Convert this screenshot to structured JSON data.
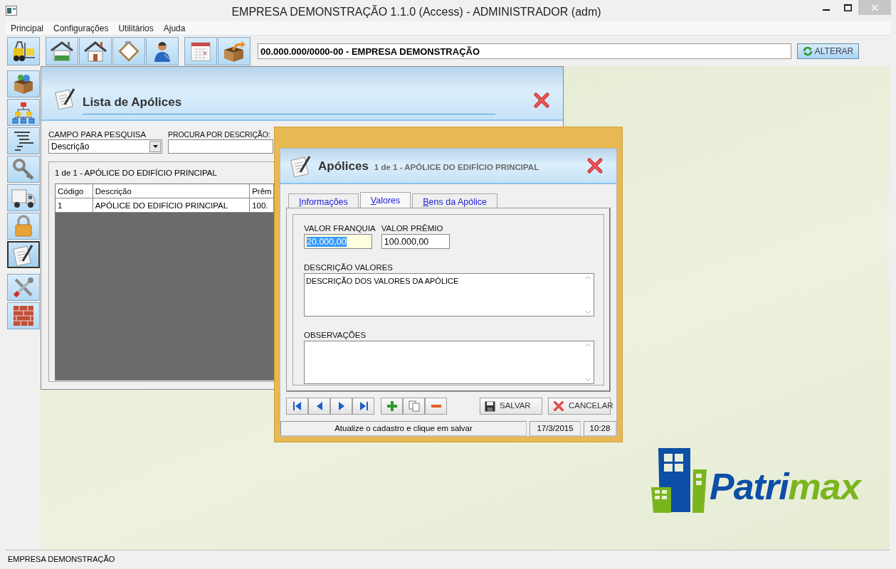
{
  "window": {
    "title": "EMPRESA DEMONSTRAÇÃO 1.1.0 (Access) - ADMINISTRADOR (adm)"
  },
  "menu": [
    "Principal",
    "Configurações",
    "Utilitários",
    "Ajuda"
  ],
  "company_field": {
    "value": "00.000.000/0000-00 - EMPRESA DEMONSTRAÇÃO"
  },
  "alter_button": {
    "label": "ALTERAR"
  },
  "sidebar": {
    "items": [
      {
        "selected": false
      },
      {
        "selected": false
      },
      {
        "selected": false
      },
      {
        "selected": false
      },
      {
        "selected": false
      },
      {
        "selected": false
      },
      {
        "selected": true
      },
      {
        "selected": false
      },
      {
        "selected": false
      }
    ]
  },
  "list_window": {
    "title": "Lista de Apólices",
    "search_field_label": "CAMPO PARA PESQUISA",
    "search_field_value": "Descrição",
    "search_label": "PROCURA POR DESCRIÇÃO:",
    "record_caption": "1 de 1 - APÓLICE DO EDIFÍCIO PRINCIPAL",
    "table": {
      "columns": [
        "Código",
        "Descrição",
        "Prêm"
      ],
      "rows": [
        {
          "cells": [
            "1",
            "APÓLICE DO EDIFÍCIO PRINCIPAL",
            "100."
          ]
        }
      ]
    }
  },
  "dialog": {
    "title": "Apólices",
    "subtitle": "1 de 1 - APÓLICE DO EDIFÍCIO PRINCIPAL",
    "tabs": [
      {
        "label": "Informações",
        "selected": false
      },
      {
        "label": "Valores",
        "selected": true
      },
      {
        "label": "Bens da Apólice",
        "selected": false
      }
    ],
    "fields": [
      {
        "label": "VALOR FRANQUIA",
        "value": "20.000,00",
        "focused": true
      },
      {
        "label": "VALOR PRÊMIO",
        "value": "100.000,00",
        "focused": false
      }
    ],
    "memos": [
      {
        "label": "DESCRIÇÃO VALORES",
        "value": "DESCRIÇÃO DOS VALORES DA APÓLICE"
      },
      {
        "label": "OBSERVAÇÕES"
      }
    ],
    "buttons": [
      {
        "label": "SALVAR",
        "kind": "save"
      },
      {
        "label": "CANCELAR",
        "kind": "cancel"
      }
    ],
    "status": {
      "message": "Atualize o cadastro e clique em salvar",
      "date": "17/3/2015",
      "time": "10:28"
    }
  },
  "logo": {
    "parts": [
      "Patri",
      "max"
    ]
  },
  "status_bar": {
    "text": "EMPRESA DEMONSTRAÇÃO"
  }
}
